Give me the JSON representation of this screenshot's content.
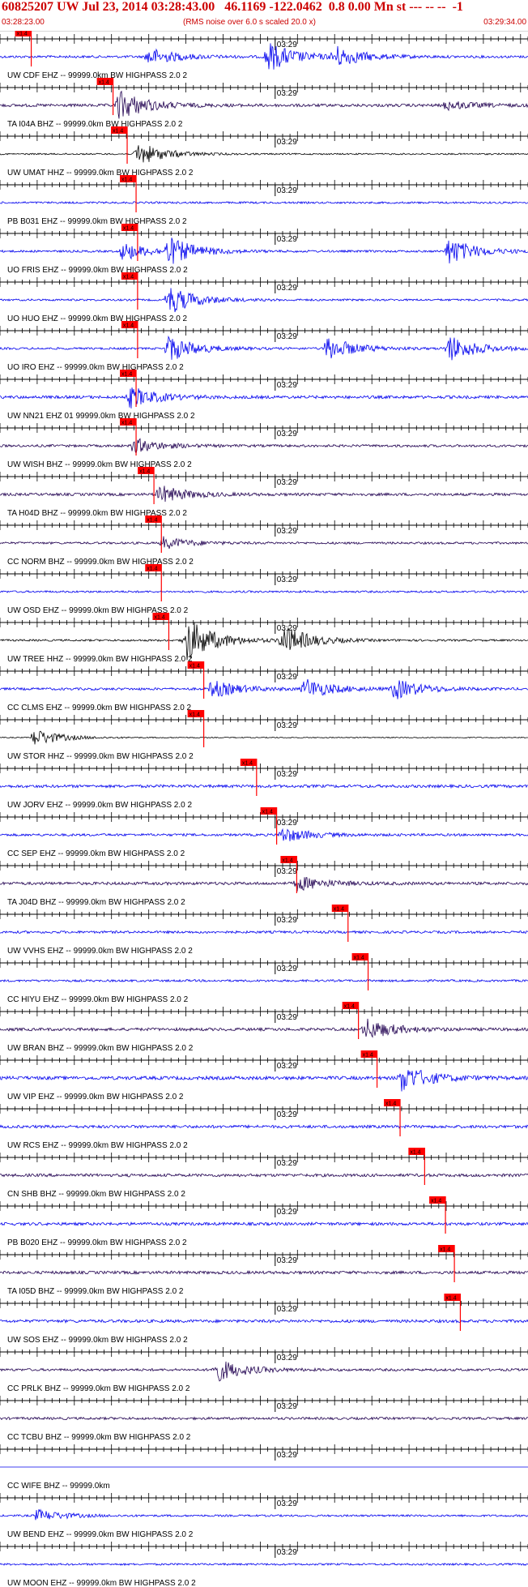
{
  "header": {
    "title": "60825207 UW Jul 23, 2014 03:28:43.00   46.1169 -122.0462  0.8 0.00 Mn st --- -- --  -1",
    "start_time": "03:28:23.00",
    "note": "(RMS noise over 6.0 s scaled 20.0 x)",
    "end_time": "03:29:34.00"
  },
  "chart_data": {
    "type": "line",
    "minute_label": "03:29",
    "pick_label": "x1.4",
    "x_range_seconds": [
      0,
      71
    ],
    "colors": {
      "trace_blue": "#0000ee",
      "trace_black": "#000000",
      "trace_purple": "#200050",
      "pick": "#ff0000",
      "axis": "#000000"
    },
    "traces": [
      {
        "label": "UW CDF EHZ -- 99999.0km BW  HIGHPASS  2.0  2",
        "color": "#0000ee",
        "amp": 0.25,
        "pick_s": 4.2,
        "events": [
          [
            20,
            0.6
          ],
          [
            36,
            1.0
          ],
          [
            45,
            0.7
          ]
        ]
      },
      {
        "label": "TA I04A BHZ -- 99999.0km BW  HIGHPASS  2.0  2",
        "color": "#200050",
        "amp": 0.3,
        "pick_s": 15.2,
        "events": [
          [
            16,
            1.0
          ],
          [
            60,
            0.3
          ]
        ]
      },
      {
        "label": "UW UMAT HHZ -- 99999.0km BW  HIGHPASS  2.0  2",
        "color": "#000000",
        "amp": 0.15,
        "pick_s": 17.1,
        "events": [
          [
            18.5,
            0.8
          ]
        ]
      },
      {
        "label": "PB B031 EHZ -- 99999.0km BW  HIGHPASS  2.0  2",
        "color": "#0000ee",
        "amp": 0.2,
        "pick_s": 18.3,
        "events": []
      },
      {
        "label": "UO FRIS EHZ -- 99999.0km BW  HIGHPASS  2.0  2",
        "color": "#0000ee",
        "amp": 0.22,
        "pick_s": 18.5,
        "events": [
          [
            16.5,
            0.6
          ],
          [
            22.6,
            0.9
          ],
          [
            60.3,
            0.9
          ]
        ]
      },
      {
        "label": "UO HUO EHZ -- 99999.0km BW  HIGHPASS  2.0  2",
        "color": "#0000ee",
        "amp": 0.2,
        "pick_s": 18.5,
        "events": [
          [
            22.6,
            1.0
          ]
        ]
      },
      {
        "label": "UO IRO EHZ -- 99999.0km BW  HIGHPASS  2.0  2",
        "color": "#0000ee",
        "amp": 0.22,
        "pick_s": 18.5,
        "events": [
          [
            22.6,
            0.9
          ],
          [
            44,
            0.8
          ],
          [
            60.3,
            0.9
          ]
        ]
      },
      {
        "label": "UW NN21 EHZ 01 99999.0km BW  HIGHPASS  2.0  2",
        "color": "#0000ee",
        "amp": 0.3,
        "pick_s": 18.3,
        "events": [
          [
            17.5,
            0.7
          ]
        ]
      },
      {
        "label": "UW WISH BHZ -- 99999.0km BW  HIGHPASS  2.0  2",
        "color": "#200050",
        "amp": 0.25,
        "pick_s": 18.3,
        "events": [
          [
            18,
            0.5
          ]
        ]
      },
      {
        "label": "TA H04D BHZ -- 99999.0km BW  HIGHPASS  2.0  2",
        "color": "#200050",
        "amp": 0.28,
        "pick_s": 20.7,
        "events": [
          [
            21.5,
            0.6
          ]
        ]
      },
      {
        "label": "CC NORM BHZ -- 99999.0km BW  HIGHPASS  2.0  2",
        "color": "#200050",
        "amp": 0.22,
        "pick_s": 21.7,
        "events": [
          [
            22,
            0.4
          ]
        ]
      },
      {
        "label": "UW OSD EHZ -- 99999.0km BW  HIGHPASS  2.0  2",
        "color": "#0000ee",
        "amp": 0.2,
        "pick_s": 21.7,
        "events": []
      },
      {
        "label": "UW TREE HHZ -- 99999.0km BW  HIGHPASS  2.0  2",
        "color": "#000000",
        "amp": 0.2,
        "pick_s": 22.7,
        "events": [
          [
            25,
            1.6
          ],
          [
            38,
            1.0
          ]
        ]
      },
      {
        "label": "CC CLMS EHZ -- 99999.0km BW  HIGHPASS  2.0  2",
        "color": "#0000ee",
        "amp": 0.25,
        "pick_s": 27.4,
        "events": [
          [
            28.5,
            0.6
          ],
          [
            41,
            0.7
          ],
          [
            53,
            0.7
          ]
        ]
      },
      {
        "label": "UW STOR HHZ -- 99999.0km BW  HIGHPASS  2.0  2",
        "color": "#000000",
        "amp": 0.1,
        "pick_s": 27.4,
        "events": [
          [
            4.6,
            0.6
          ]
        ]
      },
      {
        "label": "UW JORV EHZ -- 99999.0km BW  HIGHPASS  2.0  2",
        "color": "#0000ee",
        "amp": 0.3,
        "pick_s": 34.5,
        "events": []
      },
      {
        "label": "CC SEP EHZ -- 99999.0km BW  HIGHPASS  2.0  2",
        "color": "#0000ee",
        "amp": 0.25,
        "pick_s": 37.2,
        "events": [
          [
            38,
            0.5
          ]
        ]
      },
      {
        "label": "TA J04D BHZ -- 99999.0km BW  HIGHPASS  2.0  2",
        "color": "#200050",
        "amp": 0.3,
        "pick_s": 39.9,
        "events": [
          [
            40,
            0.5
          ]
        ]
      },
      {
        "label": "UW VVHS EHZ -- 99999.0km BW  HIGHPASS  2.0  2",
        "color": "#0000ee",
        "amp": 0.25,
        "pick_s": 46.8,
        "events": []
      },
      {
        "label": "CC HIYU EHZ -- 99999.0km BW  HIGHPASS  2.0  2",
        "color": "#0000ee",
        "amp": 0.22,
        "pick_s": 49.5,
        "events": []
      },
      {
        "label": "UW BRAN BHZ -- 99999.0km BW  HIGHPASS  2.0  2",
        "color": "#200050",
        "amp": 0.3,
        "pick_s": 48.2,
        "events": [
          [
            49.2,
            0.7
          ]
        ]
      },
      {
        "label": "UW VIP EHZ -- 99999.0km BW  HIGHPASS  2.0  2",
        "color": "#0000ee",
        "amp": 0.35,
        "pick_s": 50.7,
        "events": [
          [
            54,
            0.9
          ]
        ]
      },
      {
        "label": "UW RCS EHZ -- 99999.0km BW  HIGHPASS  2.0  2",
        "color": "#0000ee",
        "amp": 0.3,
        "pick_s": 53.8,
        "events": []
      },
      {
        "label": "CN SHB BHZ -- 99999.0km BW  HIGHPASS  2.0  2",
        "color": "#200050",
        "amp": 0.3,
        "pick_s": 57.1,
        "events": []
      },
      {
        "label": "PB B020 EHZ -- 99999.0km BW  HIGHPASS  2.0  2",
        "color": "#0000ee",
        "amp": 0.3,
        "pick_s": 59.9,
        "events": []
      },
      {
        "label": "TA I05D BHZ -- 99999.0km BW  HIGHPASS  2.0  2",
        "color": "#200050",
        "amp": 0.3,
        "pick_s": 61.1,
        "events": []
      },
      {
        "label": "UW SOS EHZ -- 99999.0km BW  HIGHPASS  2.0  2",
        "color": "#0000ee",
        "amp": 0.3,
        "pick_s": 61.9,
        "events": []
      },
      {
        "label": "CC PRLK BHZ -- 99999.0km BW  HIGHPASS  2.0  2",
        "color": "#200050",
        "amp": 0.25,
        "pick_s": null,
        "events": [
          [
            29,
            0.8
          ]
        ]
      },
      {
        "label": "CC TCBU BHZ -- 99999.0km BW  HIGHPASS  2.0  2",
        "color": "#200050",
        "amp": 0.25,
        "pick_s": null,
        "events": []
      },
      {
        "label": "CC WIFE BHZ -- 99999.0km",
        "color": "#0000ee",
        "amp": 0.0,
        "pick_s": null,
        "events": []
      },
      {
        "label": "UW BEND EHZ -- 99999.0km BW  HIGHPASS  2.0  2",
        "color": "#0000ee",
        "amp": 0.2,
        "pick_s": null,
        "events": [
          [
            5,
            0.4
          ]
        ]
      },
      {
        "label": "UW MOON EHZ -- 99999.0km BW  HIGHPASS  2.0  2",
        "color": "#0000ee",
        "amp": 0.2,
        "pick_s": null,
        "events": []
      }
    ]
  }
}
